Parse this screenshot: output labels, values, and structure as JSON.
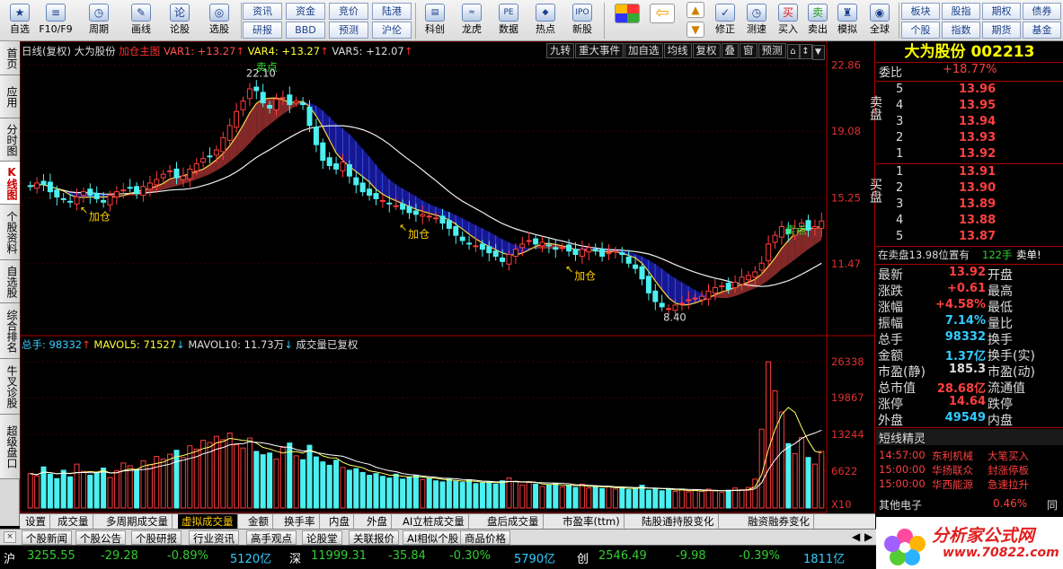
{
  "toolbar": {
    "left": [
      {
        "label": "自选",
        "icon": "star-icon"
      },
      {
        "label": "F10/F9",
        "icon": "f10-icon"
      },
      {
        "label": "周期",
        "icon": "clock-icon"
      },
      {
        "label": "画线",
        "icon": "pencil-icon"
      },
      {
        "label": "论股",
        "icon": "discuss-icon"
      },
      {
        "label": "选股",
        "icon": "stock-select-icon"
      }
    ],
    "grid": [
      [
        "资讯",
        "资金",
        "竞价",
        "陆港"
      ],
      [
        "研报",
        "BBD",
        "预测",
        "沪伦"
      ]
    ],
    "mid": [
      {
        "label": "科创",
        "icon": "kechuang-icon"
      },
      {
        "label": "龙虎",
        "icon": "dragon-tiger-icon"
      },
      {
        "label": "数据",
        "icon": "pe-data-icon"
      },
      {
        "label": "热点",
        "icon": "hot-icon"
      },
      {
        "label": "新股",
        "icon": "ipo-icon"
      }
    ],
    "right": [
      {
        "label": "修正",
        "icon": "correct-icon"
      },
      {
        "label": "测速",
        "icon": "speed-test-icon"
      },
      {
        "label": "买入",
        "icon": "buy-icon"
      },
      {
        "label": "卖出",
        "icon": "sell-icon"
      },
      {
        "label": "模拟",
        "icon": "simulate-icon"
      },
      {
        "label": "全球",
        "icon": "globe-icon"
      }
    ],
    "grid2": [
      [
        "板块",
        "股指",
        "期权",
        "债券"
      ],
      [
        "个股",
        "指数",
        "期货",
        "基金"
      ]
    ]
  },
  "sidetabs": [
    "首页",
    "应用",
    "分时图",
    "K线图",
    "个股资料",
    "自选股",
    "综合排名",
    "牛叉诊股",
    "超级盘口"
  ],
  "chart_header": {
    "period": "日线(复权)",
    "stock": "大为股份",
    "formula": "加仓主图",
    "var1": "VAR1: +13.27",
    "var4": "VAR4: +13.27",
    "var5": "VAR5: +12.07"
  },
  "chart_tools": [
    "九转",
    "重大事件",
    "加自选",
    "均线",
    "复权",
    "叠",
    "窗",
    "预测"
  ],
  "price_axis": [
    "22.86",
    "19.08",
    "15.25",
    "11.47"
  ],
  "annot": {
    "high": "22.10",
    "low": "8.40",
    "add": "加仓",
    "sell": "卖点"
  },
  "vol_header": {
    "total": "总手: 98332",
    "mavol5": "MAVOL5: 71527",
    "mavol10": "MAVOL10: 11.73万",
    "note": "成交量已复权"
  },
  "vol_axis": [
    "26338",
    "19867",
    "13244",
    "6622",
    "X10"
  ],
  "right_panel": {
    "title": "大为股份 002213",
    "weibi_label": "委比",
    "weibi": "+18.77%",
    "sell_label": "卖盘",
    "buy_label": "买盘",
    "sell": [
      [
        "5",
        "13.96"
      ],
      [
        "4",
        "13.95"
      ],
      [
        "3",
        "13.94"
      ],
      [
        "2",
        "13.93"
      ],
      [
        "1",
        "13.92"
      ]
    ],
    "buy": [
      [
        "1",
        "13.91"
      ],
      [
        "2",
        "13.90"
      ],
      [
        "3",
        "13.89"
      ],
      [
        "4",
        "13.88"
      ],
      [
        "5",
        "13.87"
      ]
    ],
    "queue": "在卖盘13.98位置有",
    "queue_qty": "122手",
    "queue_tag": "卖单!",
    "quotes": [
      [
        "最新",
        "13.92",
        "开盘",
        ""
      ],
      [
        "涨跌",
        "+0.61",
        "最高",
        ""
      ],
      [
        "涨幅",
        "+4.58%",
        "最低",
        ""
      ],
      [
        "振幅",
        "7.14%",
        "量比",
        ""
      ],
      [
        "总手",
        "98332",
        "换手",
        ""
      ],
      [
        "金额",
        "1.37亿",
        "换手(实)",
        ""
      ],
      [
        "市盈(静)",
        "185.3",
        "市盈(动)",
        ""
      ],
      [
        "总市值",
        "28.68亿",
        "流通值",
        ""
      ],
      [
        "涨停",
        "14.64",
        "跌停",
        ""
      ],
      [
        "外盘",
        "49549",
        "内盘",
        ""
      ]
    ],
    "sprite_title": "短线精灵",
    "sprite": [
      [
        "14:57:00",
        "东利机械",
        "大笔买入"
      ],
      [
        "15:00:00",
        "华扬联众",
        "封涨停板"
      ],
      [
        "15:00:00",
        "华西能源",
        "急速拉升"
      ]
    ],
    "sector": "其他电子",
    "sector_pct": "0.46%",
    "sector_tail": "同"
  },
  "bottom_tabs": [
    "设置",
    "成交量",
    "多周期成交量",
    "虚拟成交量",
    "金额",
    "换手率",
    "内盘",
    "外盘",
    "AI立桩成交量",
    "盘后成交量",
    "市盈率(ttm)",
    "陆股通持股变化",
    "融资融券变化"
  ],
  "bottom_active": 3,
  "news_tabs": [
    "个股新闻",
    "个股公告",
    "个股研报",
    "行业资讯",
    "高手观点",
    "论股堂",
    "关联报价",
    "AI相似个股",
    "商品价格"
  ],
  "status": {
    "sh_label": "沪",
    "sh_val": "3255.55",
    "sh_chg": "-29.28",
    "sh_pct": "-0.89%",
    "sh_amt": "5120亿",
    "sz_label": "深",
    "sz_val": "11999.31",
    "sz_chg": "-35.84",
    "sz_pct": "-0.30%",
    "sz_amt": "5790亿",
    "cy_label": "创",
    "cy_val": "2546.49",
    "cy_chg": "-9.98",
    "cy_pct": "-0.39%",
    "cy_amt": "1811亿"
  },
  "logo": {
    "text": "分析家公式网",
    "url": "www.70822.com"
  },
  "chart_data": {
    "type": "candlestick",
    "y_range": [
      7.5,
      23.2
    ],
    "closes": [
      15.9,
      16.1,
      16.0,
      15.6,
      15.3,
      15.2,
      15.0,
      15.3,
      15.6,
      15.4,
      15.2,
      15.0,
      15.4,
      15.6,
      15.7,
      15.8,
      15.5,
      15.9,
      16.1,
      16.3,
      16.6,
      16.8,
      16.4,
      16.5,
      16.9,
      17.2,
      17.5,
      17.6,
      18.0,
      18.7,
      19.4,
      20.2,
      20.8,
      21.5,
      21.4,
      20.7,
      20.4,
      20.9,
      21.0,
      20.6,
      20.8,
      20.6,
      19.4,
      18.3,
      17.4,
      17.1,
      16.9,
      17.3,
      16.5,
      16.0,
      15.6,
      15.4,
      15.2,
      15.1,
      14.9,
      14.8,
      14.6,
      14.4,
      14.3,
      14.3,
      14.2,
      14.1,
      13.8,
      13.5,
      13.1,
      12.8,
      12.6,
      12.5,
      12.3,
      12.1,
      11.9,
      11.6,
      12.0,
      12.3,
      12.6,
      12.8,
      12.6,
      12.7,
      12.5,
      12.3,
      12.4,
      12.2,
      12.0,
      12.3,
      12.4,
      12.2,
      11.9,
      12.1,
      12.2,
      12.0,
      11.5,
      11.2,
      10.6,
      9.8,
      9.3,
      9.0,
      8.9,
      9.1,
      9.2,
      9.4,
      9.5,
      9.6,
      9.9,
      10.1,
      10.2,
      10.0,
      10.4,
      10.7,
      10.8,
      11.0,
      11.5,
      12.6,
      13.1,
      13.6,
      13.2,
      13.5,
      13.8,
      13.4,
      13.6,
      13.92
    ],
    "volumes": [
      6200,
      5800,
      7400,
      6100,
      5300,
      6800,
      5600,
      7900,
      6600,
      5900,
      6300,
      7200,
      5500,
      6700,
      8100,
      7600,
      6900,
      8500,
      7800,
      9300,
      8800,
      9700,
      10400,
      9100,
      11200,
      10600,
      12200,
      11800,
      12900,
      12300,
      13500,
      11400,
      10800,
      12600,
      10200,
      9600,
      9900,
      8800,
      10900,
      11700,
      9400,
      8700,
      11300,
      9200,
      8300,
      7700,
      8600,
      7300,
      6800,
      7100,
      6400,
      5900,
      6200,
      5700,
      5400,
      6100,
      5200,
      5600,
      5900,
      5100,
      5300,
      4900,
      4700,
      5200,
      4800,
      4600,
      5000,
      4400,
      4500,
      4700,
      4300,
      4900,
      5400,
      4800,
      4100,
      4600,
      4300,
      3900,
      4200,
      4400,
      3800,
      4100,
      3700,
      4300,
      3600,
      3900,
      3500,
      3800,
      3400,
      3700,
      3300,
      3600,
      4100,
      3200,
      3500,
      3100,
      3400,
      3000,
      3300,
      2900,
      3200,
      3000,
      3400,
      3100,
      2800,
      3200,
      3600,
      3300,
      3700,
      5200,
      14200,
      26338,
      21100,
      17300,
      11600,
      9800,
      12700,
      9100,
      7900,
      10200
    ]
  }
}
